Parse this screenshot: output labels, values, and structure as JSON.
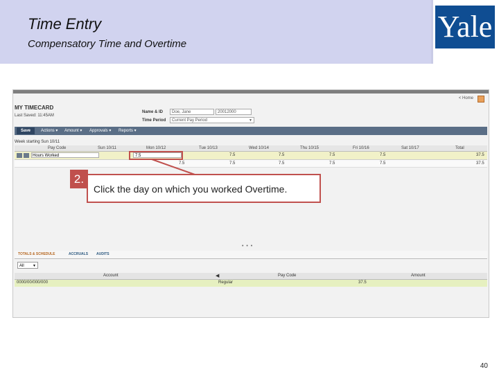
{
  "slide": {
    "title": "Time Entry",
    "subtitle": "Compensatory Time and Overtime",
    "logo_text": "Yale",
    "page_number": "40"
  },
  "timecard": {
    "home_link": "< Home",
    "title": "MY TIMECARD",
    "last_saved": "Last Saved: 11:45AM",
    "name_label": "Name & ID",
    "name_value": "Doe, Jane",
    "id_value": "20012000",
    "time_period_label": "Time Period",
    "time_period_value": "Current Pay Period",
    "toolbar": {
      "save": "Save",
      "actions": "Actions ▾",
      "amount": "Amount ▾",
      "approvals": "Approvals ▾",
      "reports": "Reports ▾"
    },
    "week_label": "Week starting Sun 10/11",
    "columns": [
      "Pay Code",
      "Sun 10/11",
      "Mon 10/12",
      "Tue 10/13",
      "Wed 10/14",
      "Thu 10/15",
      "Fri 10/16",
      "Sat 10/17",
      "Total"
    ],
    "rows": [
      {
        "pay_code": "Hours Worked",
        "sun": "",
        "mon": "7.5",
        "tue": "7.5",
        "wed": "7.5",
        "thu": "7.5",
        "fri": "7.5",
        "sat": "",
        "total": "37.5"
      },
      {
        "pay_code": "",
        "sun": "",
        "mon": "7.5",
        "tue": "7.5",
        "wed": "7.5",
        "thu": "7.5",
        "fri": "7.5",
        "sat": "",
        "total": "37.5"
      }
    ],
    "bottom_tabs": [
      "TOTALS & SCHEDULE",
      "ACCRUALS",
      "AUDITS"
    ],
    "filter_value": "All",
    "bottom_columns": [
      "Account",
      "Pay Code",
      "Amount"
    ],
    "bottom_row": {
      "account": "0000/00/000/000",
      "pay_code": "Regular",
      "amount": "37.5"
    }
  },
  "callout": {
    "number": "2.",
    "text": "Click the day on which you worked Overtime."
  },
  "colors": {
    "header_bg": "#d1d3ef",
    "yale_blue": "#0f4d92",
    "callout_red": "#c0504d"
  }
}
